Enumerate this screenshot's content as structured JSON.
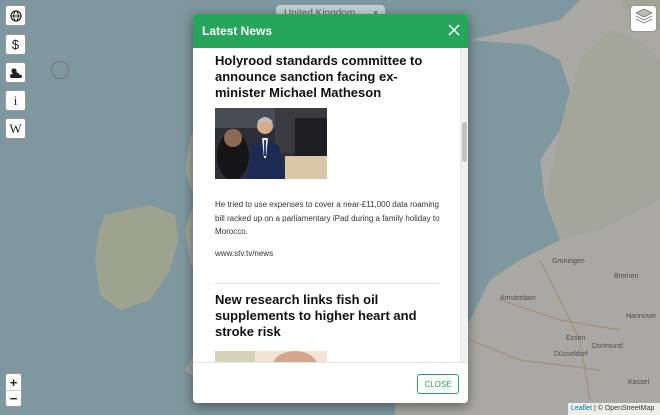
{
  "map": {
    "country_selector": "United Kingdom",
    "zoom_in_label": "+",
    "zoom_out_label": "−",
    "attribution_leaflet": "Leaflet",
    "attribution_rest": " | © OpenStreetMap",
    "place_labels": [
      "Groningen",
      "Bremen",
      "Amsterdam",
      "Hannover",
      "Düsseldorf",
      "Dortmund",
      "Essen",
      "Kassel"
    ],
    "toolbar": [
      {
        "name": "globe-icon"
      },
      {
        "name": "dollar-icon",
        "glyph": "$"
      },
      {
        "name": "weather-icon"
      },
      {
        "name": "info-icon",
        "glyph": "i"
      },
      {
        "name": "wikipedia-icon",
        "glyph": "W"
      }
    ]
  },
  "modal": {
    "title": "Latest News",
    "close_button": "CLOSE",
    "articles": [
      {
        "title": "Holyrood standards committee to announce sanction facing ex-minister Michael Matheson",
        "description": "He tried to use expenses to cover a near-£11,000 data roaming bill racked up on a parliamentary iPad during a family holiday to Morocco.",
        "source": "www.stv.tv/news"
      },
      {
        "title": "New research links fish oil supplements to higher heart and stroke risk"
      }
    ]
  },
  "colors": {
    "header_green": "#26a65b",
    "map_sea": "#aad3df",
    "map_land": "#f2efe9"
  }
}
